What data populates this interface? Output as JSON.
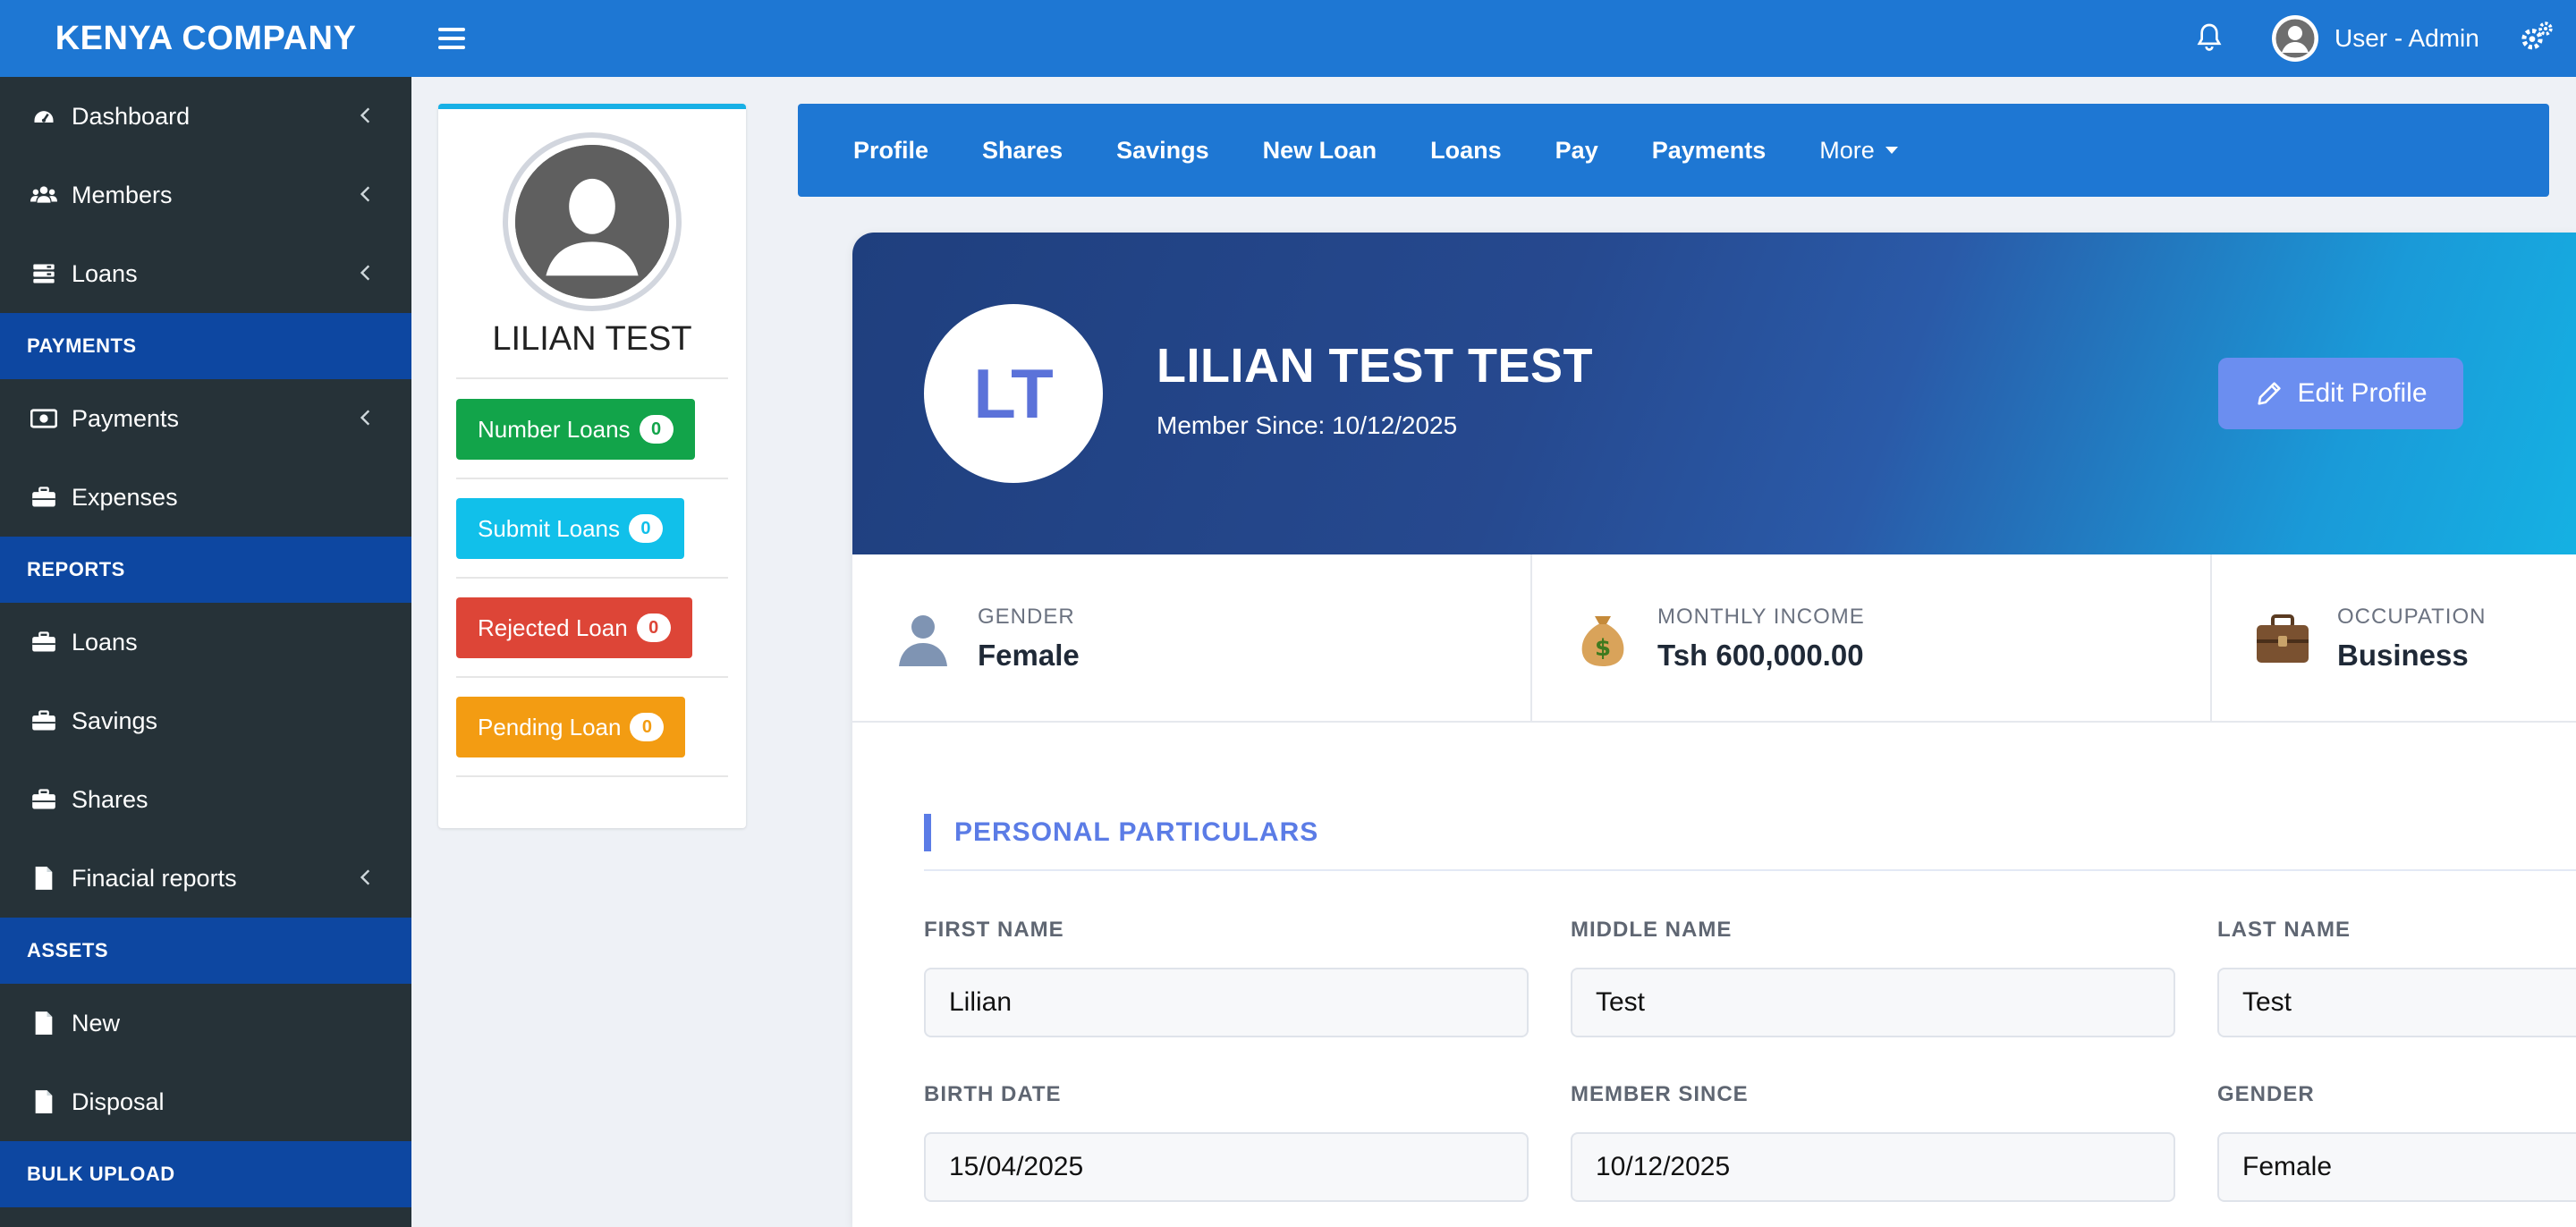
{
  "header": {
    "brand": "KENYA COMPANY",
    "user_label": "User - Admin"
  },
  "sidebar": {
    "items": [
      {
        "type": "item",
        "label": "Dashboard",
        "icon": "dashboard-icon",
        "chevron": true
      },
      {
        "type": "item",
        "label": "Members",
        "icon": "users-icon",
        "chevron": true
      },
      {
        "type": "item",
        "label": "Loans",
        "icon": "server-icon",
        "chevron": true
      },
      {
        "type": "header",
        "label": "PAYMENTS"
      },
      {
        "type": "item",
        "label": "Payments",
        "icon": "money-icon",
        "chevron": true
      },
      {
        "type": "item",
        "label": "Expenses",
        "icon": "briefcase-icon",
        "chevron": false
      },
      {
        "type": "header",
        "label": "REPORTS"
      },
      {
        "type": "item",
        "label": "Loans",
        "icon": "briefcase-icon",
        "chevron": false
      },
      {
        "type": "item",
        "label": "Savings",
        "icon": "briefcase-icon",
        "chevron": false
      },
      {
        "type": "item",
        "label": "Shares",
        "icon": "briefcase-icon",
        "chevron": false
      },
      {
        "type": "item",
        "label": "Finacial reports",
        "icon": "file-icon",
        "chevron": true
      },
      {
        "type": "header",
        "label": "ASSETS"
      },
      {
        "type": "item",
        "label": "New",
        "icon": "file-icon",
        "chevron": false
      },
      {
        "type": "item",
        "label": "Disposal",
        "icon": "file-icon",
        "chevron": false
      },
      {
        "type": "header",
        "label": "BULK UPLOAD"
      }
    ]
  },
  "profile_card": {
    "name": "LILIAN TEST",
    "buttons": [
      {
        "label": "Number Loans",
        "count": "0",
        "color": "#12a44a"
      },
      {
        "label": "Submit Loans",
        "count": "0",
        "color": "#11c0ea"
      },
      {
        "label": "Rejected Loan",
        "count": "0",
        "color": "#dd4537"
      },
      {
        "label": "Pending Loan",
        "count": "0",
        "color": "#f39c12"
      }
    ]
  },
  "tabs": [
    "Profile",
    "Shares",
    "Savings",
    "New Loan",
    "Loans",
    "Pay",
    "Payments"
  ],
  "tabs_more": "More",
  "hero": {
    "initials": "LT",
    "name": "LILIAN TEST TEST",
    "member_since": "Member Since: 10/12/2025",
    "edit_label": "Edit Profile"
  },
  "stats": [
    {
      "label": "GENDER",
      "value": "Female",
      "icon": "person-icon"
    },
    {
      "label": "MONTHLY INCOME",
      "value": "Tsh 600,000.00",
      "icon": "money-bag-icon"
    },
    {
      "label": "OCCUPATION",
      "value": "Business",
      "icon": "briefcase-icon"
    }
  ],
  "section": {
    "title": "PERSONAL PARTICULARS"
  },
  "fields": [
    {
      "label": "FIRST NAME",
      "value": "Lilian"
    },
    {
      "label": "MIDDLE NAME",
      "value": "Test"
    },
    {
      "label": "LAST NAME",
      "value": "Test"
    },
    {
      "label": "BIRTH DATE",
      "value": "15/04/2025"
    },
    {
      "label": "MEMBER SINCE",
      "value": "10/12/2025"
    },
    {
      "label": "GENDER",
      "value": "Female"
    }
  ],
  "colors": {
    "topbar": "#1e77d3",
    "sidebar": "#263238",
    "sidebar_header": "#0d47a1",
    "accent": "#5b7ce6"
  }
}
